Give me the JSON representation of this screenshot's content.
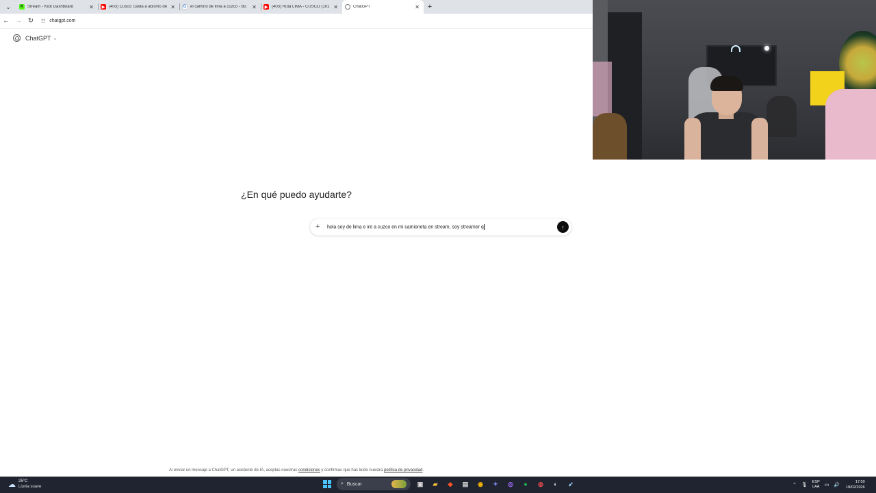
{
  "browser": {
    "tabs": [
      {
        "title": "Stream - Kick Dashboard",
        "favicon": "kick-icon",
        "color": "#53fc18",
        "active": false
      },
      {
        "title": "(403) Cusco: caída a abismo de",
        "favicon": "youtube-icon",
        "color": "#ff0000",
        "active": false
      },
      {
        "title": "el camino de lima a cuzco - Bu",
        "favicon": "google-icon",
        "color": "#4285f4",
        "active": false
      },
      {
        "title": "(403) Ruta LIMA - CUSCO (101",
        "favicon": "youtube-icon",
        "color": "#ff0000",
        "active": false
      },
      {
        "title": "ChatGPT",
        "favicon": "chatgpt-icon",
        "color": "#777777",
        "active": true
      }
    ],
    "url": "chatgpt.com"
  },
  "chatgpt": {
    "brand": "ChatGPT",
    "headline": "¿En qué puedo ayudarte?",
    "composer_text": "hola soy de lima e ire a cuzco en mi camioneta en stream, soy streamer q",
    "disclaimer_pre": "Al enviar un mensaje a ChatGPT, un asistente de IA, aceptas nuestras",
    "disclaimer_link1": "condiciones",
    "disclaimer_mid": "y confirmas que has leído nuestra",
    "disclaimer_link2": "política de privacidad",
    "disclaimer_end": "."
  },
  "taskbar": {
    "weather_temp": "25°C",
    "weather_desc": "Lluvia suave",
    "search_placeholder": "Buscar",
    "lang_top": "ESP",
    "lang_bottom": "LAA",
    "time": "17:50",
    "date": "18/02/2026"
  },
  "colors": {
    "send_button": "#0d0d0d",
    "taskbar_bg": "#1f2430",
    "tabbar_bg": "#dfe3e8"
  }
}
